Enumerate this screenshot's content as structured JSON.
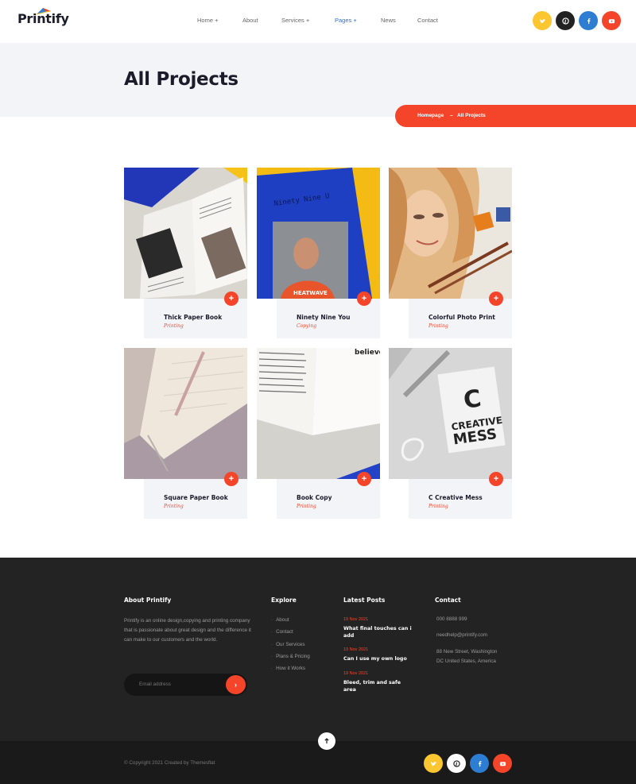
{
  "brand": {
    "name": "Printify"
  },
  "nav": [
    {
      "label": "Home +",
      "active": false
    },
    {
      "label": "About",
      "active": false
    },
    {
      "label": "Services +",
      "active": false
    },
    {
      "label": "Pages +",
      "active": true
    },
    {
      "label": "News",
      "active": false
    },
    {
      "label": "Contact",
      "active": false
    }
  ],
  "socials": [
    {
      "icon": "twitter-icon",
      "color": "#fbc62f"
    },
    {
      "icon": "pinterest-icon",
      "color": "#222222"
    },
    {
      "icon": "facebook-icon",
      "color": "#2d7dd2"
    },
    {
      "icon": "youtube-icon",
      "color": "#f4452a"
    }
  ],
  "page": {
    "title": "All Projects",
    "breadcrumb": {
      "home": "Homepage",
      "separator": "–",
      "current": "All Projects"
    }
  },
  "projects": [
    {
      "title": "Thick Paper Book",
      "category": "Printing"
    },
    {
      "title": "Ninety Nine You",
      "category": "Copying"
    },
    {
      "title": "Colorful Photo Print",
      "category": "Printing"
    },
    {
      "title": "Square Paper Book",
      "category": "Printing"
    },
    {
      "title": "Book Copy",
      "category": "Printing"
    },
    {
      "title": "C Creative Mess",
      "category": "Printing"
    }
  ],
  "images": {
    "book_cover_title": "Ninety Nine U",
    "shirt_text": "HEATWAVE",
    "mess_letter": "C",
    "mess_line1": "CREATIVE",
    "mess_line2": "MESS",
    "quote_text": "believe relatio or wo healt"
  },
  "footer": {
    "about": {
      "heading": "About Printify",
      "text": "Printify is an online design,copying and printing company that is passionate about great design and the difference it can make to our customers and the world.",
      "email_placeholder": "Email address"
    },
    "explore": {
      "heading": "Explore",
      "items": [
        "About",
        "Contact",
        "Our Services",
        "Plans & Pricing",
        "How it Works"
      ]
    },
    "posts": {
      "heading": "Latest Posts",
      "items": [
        {
          "date": "19 Nov 2021",
          "title": "What final touches can i add"
        },
        {
          "date": "19 Nov 2021",
          "title": "Can I use my own logo"
        },
        {
          "date": "19 Nov 2021",
          "title": "Bleed, trim and safe area"
        }
      ]
    },
    "contact": {
      "heading": "Contact",
      "phone": "000 8888 999",
      "email": "needhelp@printify.com",
      "address_line1": "88 New Street, Washington",
      "address_line2": "DC United States, America"
    },
    "copyright": "© Copyright 2021 Created by Themesflat"
  }
}
